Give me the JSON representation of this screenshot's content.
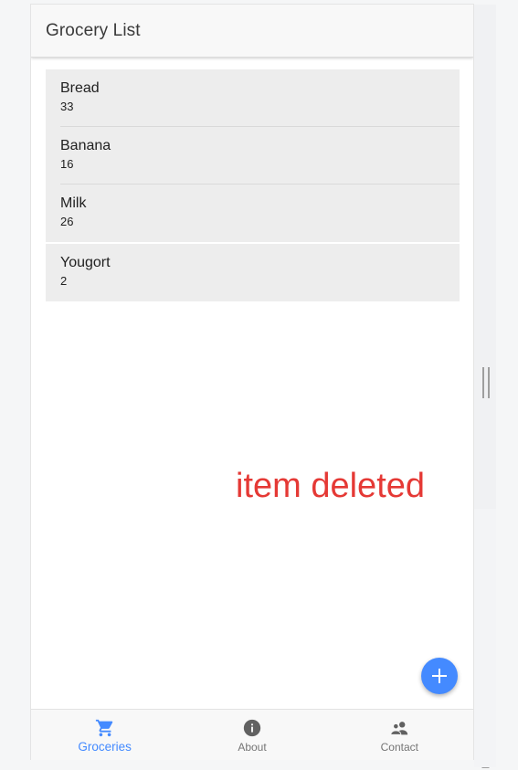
{
  "app_bar": {
    "title": "Grocery List"
  },
  "groceries": [
    {
      "name": "Bread",
      "qty": "33"
    },
    {
      "name": "Banana",
      "qty": "16"
    },
    {
      "name": "Milk",
      "qty": "26"
    },
    {
      "name": "Yougort",
      "qty": "2"
    }
  ],
  "toast": {
    "text": "item deleted",
    "color": "#e53935"
  },
  "fab": {
    "icon": "plus-icon",
    "label": "+"
  },
  "bottom_nav": {
    "items": [
      {
        "label": "Groceries",
        "icon": "cart-icon",
        "active": true
      },
      {
        "label": "About",
        "icon": "info-icon",
        "active": false
      },
      {
        "label": "Contact",
        "icon": "contacts-icon",
        "active": false
      }
    ]
  },
  "colors": {
    "accent": "#448aff",
    "list_bg": "#ededed",
    "icon_gray": "#616161"
  }
}
